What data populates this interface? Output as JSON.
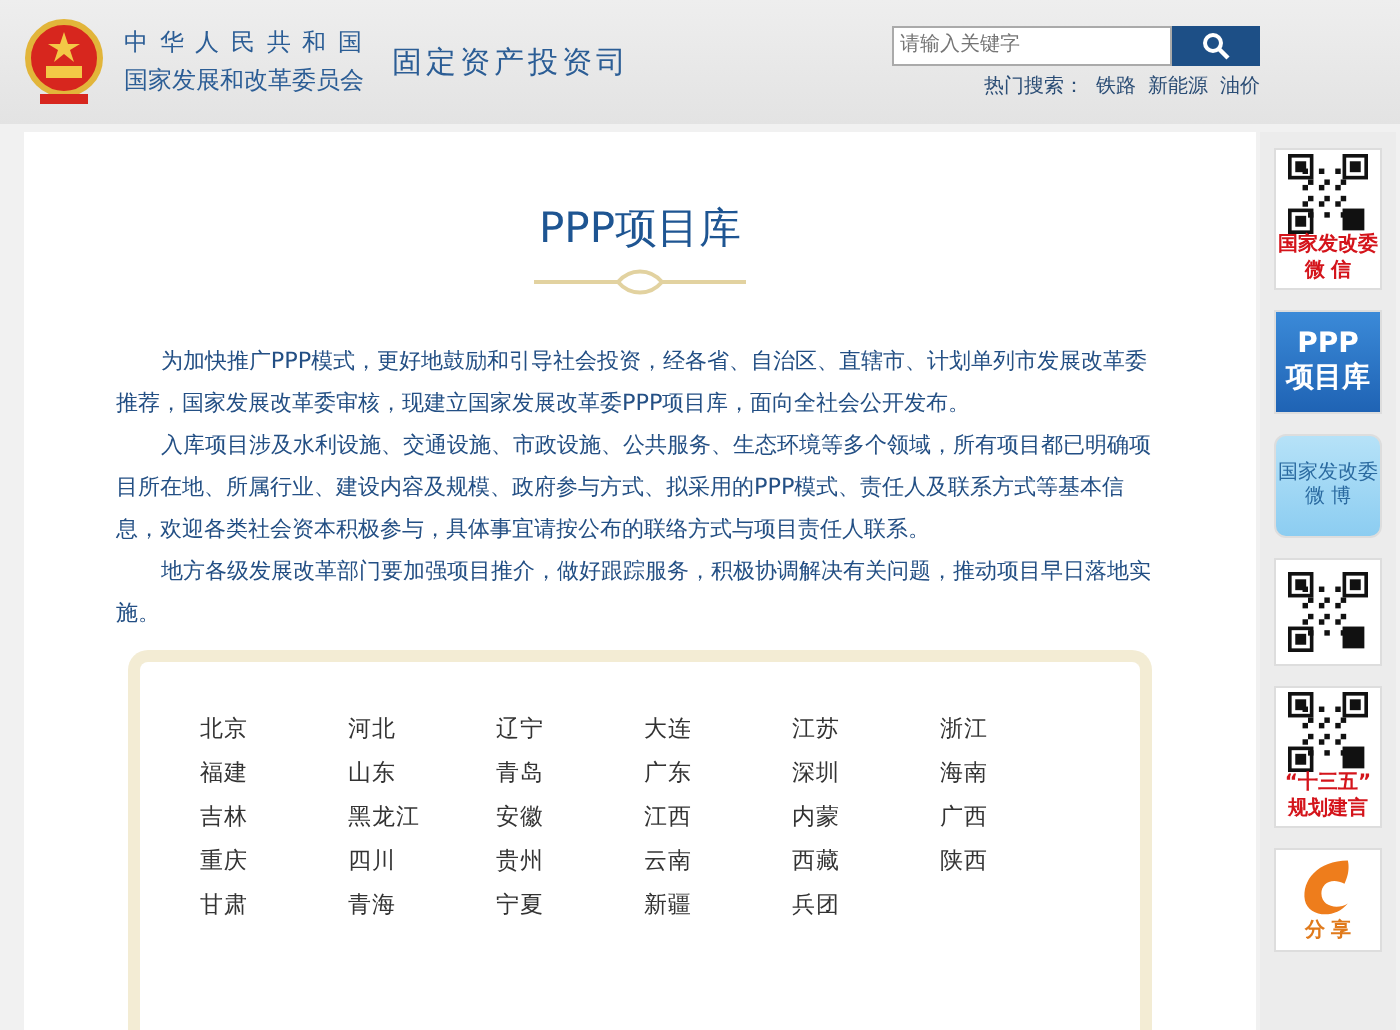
{
  "header": {
    "org_line1": "中 华 人 民 共 和 国",
    "org_line2": "国家发展和改革委员会",
    "department": "固定资产投资司"
  },
  "search": {
    "placeholder": "请输入关键字"
  },
  "hot_search": {
    "label": "热门搜索：",
    "terms": [
      "铁路",
      "新能源",
      "油价"
    ]
  },
  "title": "PPP项目库",
  "paragraphs": [
    "为加快推广PPP模式，更好地鼓励和引导社会投资，经各省、自治区、直辖市、计划单列市发展改革委推荐，国家发展改革委审核，现建立国家发展改革委PPP项目库，面向全社会公开发布。",
    "入库项目涉及水利设施、交通设施、市政设施、公共服务、生态环境等多个领域，所有项目都已明确项目所在地、所属行业、建设内容及规模、政府参与方式、拟采用的PPP模式、责任人及联系方式等基本信息，欢迎各类社会资本积极参与，具体事宜请按公布的联络方式与项目责任人联系。",
    "地方各级发展改革部门要加强项目推介，做好跟踪服务，积极协调解决有关问题，推动项目早日落地实施。"
  ],
  "regions": [
    "北京",
    "河北",
    "辽宁",
    "大连",
    "江苏",
    "浙江",
    "福建",
    "山东",
    "青岛",
    "广东",
    "深圳",
    "海南",
    "吉林",
    "黑龙江",
    "安徽",
    "江西",
    "内蒙",
    "广西",
    "重庆",
    "四川",
    "贵州",
    "云南",
    "西藏",
    "陕西",
    "甘肃",
    "青海",
    "宁夏",
    "新疆",
    "兵团"
  ],
  "sidebar": [
    {
      "kind": "qr",
      "lines": [
        "国家发改委",
        "微 信"
      ]
    },
    {
      "kind": "ppp",
      "lines": [
        "PPP",
        "项目库"
      ]
    },
    {
      "kind": "weibo",
      "lines": [
        "国家发改委",
        "微 博"
      ]
    },
    {
      "kind": "qr"
    },
    {
      "kind": "qr",
      "lines": [
        "“十三五”",
        "规划建言"
      ]
    },
    {
      "kind": "share",
      "lines": [
        "分 享"
      ]
    }
  ]
}
